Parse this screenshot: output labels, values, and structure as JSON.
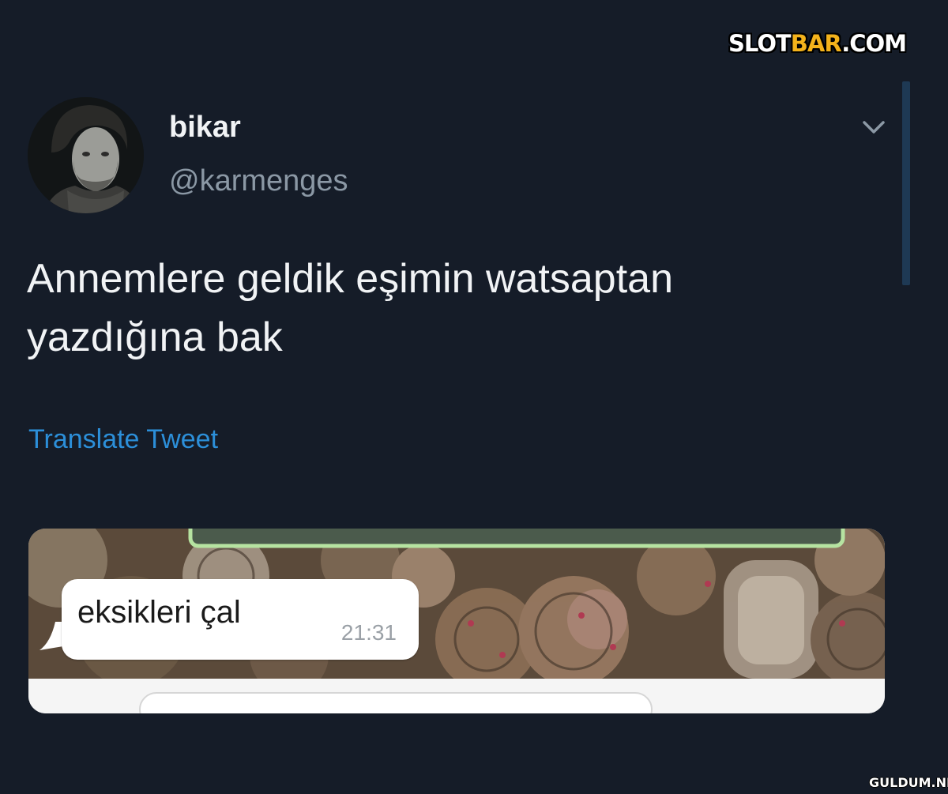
{
  "watermark": {
    "brand_start": "SLOT",
    "brand_mid": "BAR",
    "brand_end": ".COM",
    "footer": "GULDUM.NET"
  },
  "tweet": {
    "display_name": "bikar",
    "handle": "@karmenges",
    "text_line1": "Annemlere geldik eşimin watsaptan",
    "text_line2": "yazdığına bak",
    "translate_label": "Translate Tweet",
    "menu_icon": "chevron-down-icon",
    "avatar_icon": "profile-photo"
  },
  "chat_screenshot": {
    "message": "eksikleri çal",
    "time": "21:31",
    "background": "watch-movements-photo"
  },
  "colors": {
    "background": "#151c28",
    "link": "#2c8fd9",
    "handle": "#8b98a5",
    "brand_accent": "#f3b21b"
  }
}
